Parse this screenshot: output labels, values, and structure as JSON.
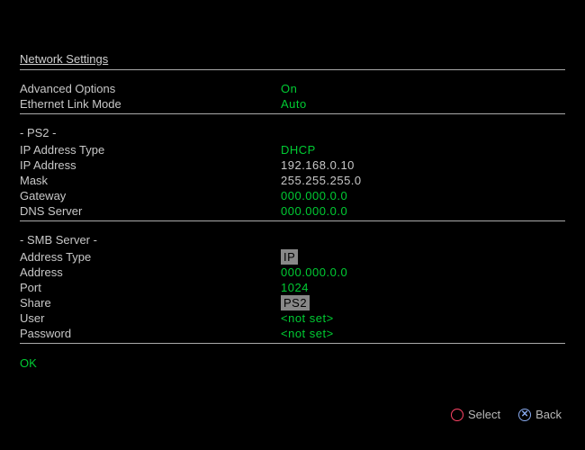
{
  "title": "Network Settings",
  "rows1": [
    {
      "label": "Advanced Options",
      "value": "On",
      "green": true
    },
    {
      "label": "Ethernet Link Mode",
      "value": "Auto",
      "green": true
    }
  ],
  "section_ps2": "- PS2 -",
  "rows2": [
    {
      "label": "IP Address Type",
      "value": "DHCP",
      "green": true
    },
    {
      "label": "IP Address",
      "value": "192.168.0.10",
      "green": false
    },
    {
      "label": "Mask",
      "value": "255.255.255.0",
      "green": false
    },
    {
      "label": "Gateway",
      "value": "000.000.0.0",
      "green": true
    },
    {
      "label": "DNS Server",
      "value": "000.000.0.0",
      "green": true
    }
  ],
  "section_smb": "- SMB Server -",
  "rows3": [
    {
      "label": "Address Type",
      "value": "IP",
      "green": false,
      "highlight": true
    },
    {
      "label": "Address",
      "value": "000.000.0.0",
      "green": true
    },
    {
      "label": "Port",
      "value": "1024",
      "green": true
    },
    {
      "label": "Share",
      "value": "PS2",
      "green": true,
      "highlight": true
    },
    {
      "label": "User",
      "value": "<not set>",
      "green": true
    },
    {
      "label": "Password",
      "value": "<not set>",
      "green": true
    }
  ],
  "ok": "OK",
  "footer": {
    "select": "Select",
    "back": "Back"
  }
}
